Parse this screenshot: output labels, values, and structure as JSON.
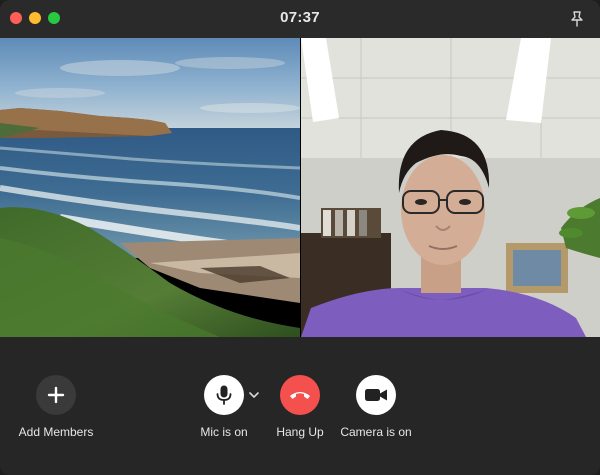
{
  "window": {
    "title": "07:37",
    "controls": [
      "close",
      "minimize",
      "maximize"
    ],
    "pin_icon": "pin-icon"
  },
  "videos": [
    {
      "participant": "self",
      "content": "coastal-scene-video"
    },
    {
      "participant": "remote",
      "content": "person-video"
    }
  ],
  "toolbar": {
    "add_members_label": "Add Members",
    "mic_label": "Mic is on",
    "hang_up_label": "Hang Up",
    "camera_label": "Camera is on"
  },
  "colors": {
    "hang_up": "#f4514e",
    "close": "#ff5f57",
    "minimize": "#febc2e",
    "maximize": "#28c840"
  }
}
